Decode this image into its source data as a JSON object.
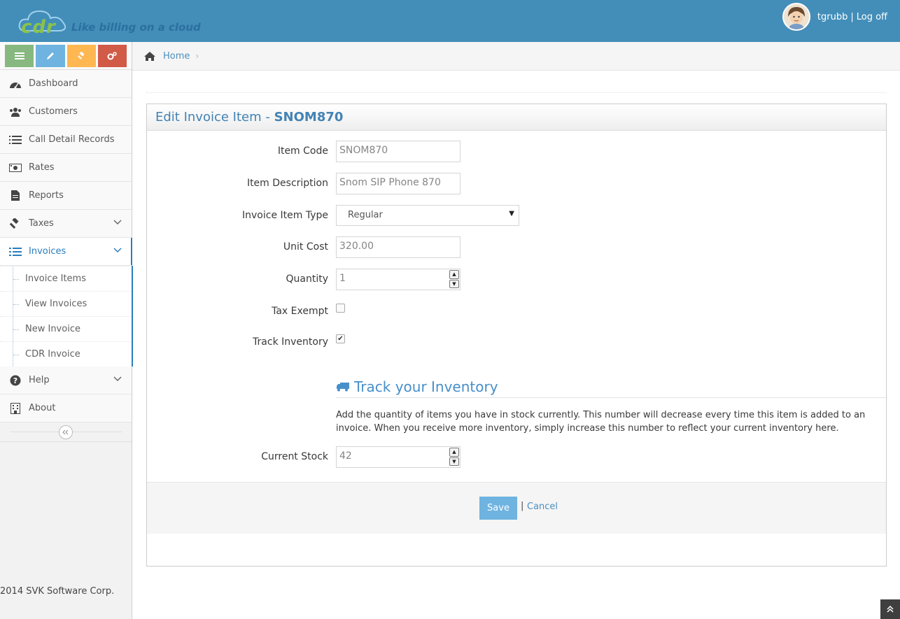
{
  "header": {
    "logo_text": "cdr",
    "tagline": "Like billing on a cloud",
    "username": "tgrubb",
    "separator": "|",
    "logoff": "Log off"
  },
  "sidebar": {
    "items": [
      {
        "label": "Dashboard"
      },
      {
        "label": "Customers"
      },
      {
        "label": "Call Detail Records"
      },
      {
        "label": "Rates"
      },
      {
        "label": "Reports"
      },
      {
        "label": "Taxes"
      },
      {
        "label": "Invoices"
      },
      {
        "label": "Help"
      },
      {
        "label": "About"
      }
    ],
    "invoice_sub": [
      {
        "label": "Invoice Items"
      },
      {
        "label": "View Invoices"
      },
      {
        "label": "New Invoice"
      },
      {
        "label": "CDR Invoice"
      }
    ],
    "footer": "2014 SVK Software Corp."
  },
  "breadcrumb": {
    "home": "Home"
  },
  "form": {
    "title_prefix": "Edit Invoice Item - ",
    "title_item": "SNOM870",
    "item_code_label": "Item Code",
    "item_code_value": "SNOM870",
    "item_desc_label": "Item Description",
    "item_desc_value": "Snom SIP Phone 870",
    "type_label": "Invoice Item Type",
    "type_value": "Regular",
    "unit_cost_label": "Unit Cost",
    "unit_cost_value": "320.00",
    "quantity_label": "Quantity",
    "quantity_value": "1",
    "tax_exempt_label": "Tax Exempt",
    "tax_exempt_checked": false,
    "track_inventory_label": "Track Inventory",
    "track_inventory_checked": true,
    "track_title": "Track your Inventory",
    "track_desc": "Add the quantity of items you have in stock currently. This number will decrease every time this item is added to an invoice. When you receive more inventory, simply increase this number to reflect your current inventory here.",
    "stock_label": "Current Stock",
    "stock_value": "42",
    "save_label": "Save",
    "actions_sep": "|",
    "cancel_label": "Cancel"
  },
  "colors": {
    "navbar": "#438eb9",
    "accent": "#2b7dbc",
    "save": "#6fb3e0"
  }
}
